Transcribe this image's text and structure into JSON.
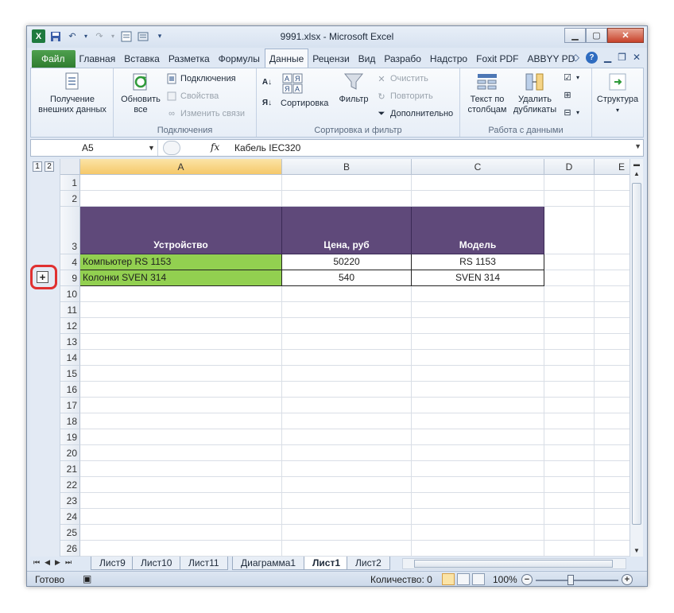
{
  "window": {
    "title": "9991.xlsx - Microsoft Excel",
    "logo": "X"
  },
  "qat_icons": [
    "save-icon",
    "undo-icon",
    "redo-icon",
    "form-icon",
    "sort-icon",
    "customize-qat-icon"
  ],
  "tabs": [
    {
      "label": "Файл",
      "key": "file"
    },
    {
      "label": "Главная"
    },
    {
      "label": "Вставка"
    },
    {
      "label": "Разметка"
    },
    {
      "label": "Формулы"
    },
    {
      "label": "Данные",
      "active": true
    },
    {
      "label": "Рецензи"
    },
    {
      "label": "Вид"
    },
    {
      "label": "Разрабо"
    },
    {
      "label": "Надстро"
    },
    {
      "label": "Foxit PDF"
    },
    {
      "label": "ABBYY PD"
    }
  ],
  "ribbon": {
    "get_external": "Получение внешних данных",
    "get_external_line1": "Получение",
    "get_external_line2": "внешних данных",
    "refresh_line1": "Обновить",
    "refresh_line2": "все",
    "connections": "Подключения",
    "properties": "Свойства",
    "edit_links": "Изменить связи",
    "group_connections": "Подключения",
    "sort": "Сортировка",
    "filter": "Фильтр",
    "clear": "Очистить",
    "reapply": "Повторить",
    "advanced": "Дополнительно",
    "group_sort": "Сортировка и фильтр",
    "text_to_cols_line1": "Текст по",
    "text_to_cols_line2": "столбцам",
    "remove_dup_line1": "Удалить",
    "remove_dup_line2": "дубликаты",
    "group_data_tools": "Работа с данными",
    "outline": "Структура",
    "sort_az": "А Я",
    "sort_za": "Я А"
  },
  "formula_bar": {
    "name_box": "A5",
    "fx": "fx",
    "content": "Кабель IEC320"
  },
  "outline": {
    "levels": [
      "1",
      "2"
    ],
    "expand_symbol": "+"
  },
  "columns": [
    "A",
    "B",
    "C",
    "D",
    "E"
  ],
  "rows": [
    {
      "num": "1",
      "cells": [
        "",
        "",
        ""
      ]
    },
    {
      "num": "2",
      "cells": [
        "",
        "",
        ""
      ]
    },
    {
      "num": "3",
      "cells": [
        "Устройство",
        "Цена, руб",
        "Модель"
      ],
      "header": true
    },
    {
      "num": "4",
      "cells": [
        "Компьютер RS 1153",
        "50220",
        "RS 1153"
      ]
    },
    {
      "num": "9",
      "cells": [
        "Колонки  SVEN 314",
        "540",
        "SVEN 314"
      ]
    },
    {
      "num": "10"
    },
    {
      "num": "11"
    },
    {
      "num": "12"
    },
    {
      "num": "13"
    },
    {
      "num": "14"
    },
    {
      "num": "15"
    },
    {
      "num": "16"
    },
    {
      "num": "17"
    },
    {
      "num": "18"
    },
    {
      "num": "19"
    },
    {
      "num": "20"
    },
    {
      "num": "21"
    },
    {
      "num": "22"
    },
    {
      "num": "23"
    },
    {
      "num": "24"
    },
    {
      "num": "25"
    },
    {
      "num": "26"
    }
  ],
  "sheets": [
    {
      "label": "Лист9"
    },
    {
      "label": "Лист10"
    },
    {
      "label": "Лист11"
    },
    {
      "label": "Диаграмма1"
    },
    {
      "label": "Лист1",
      "active": true
    },
    {
      "label": "Лист2"
    }
  ],
  "status": {
    "ready": "Готово",
    "count": "Количество: 0",
    "zoom": "100%"
  },
  "colors": {
    "header_fill": "#5f497a",
    "green_fill": "#92d050",
    "file_tab": "#2f7d2f"
  }
}
